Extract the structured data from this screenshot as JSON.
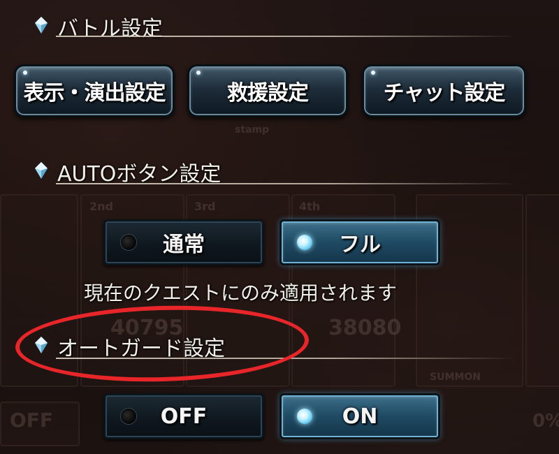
{
  "battle_settings": {
    "title": "バトル設定",
    "buttons": [
      {
        "label": "表示・演出設定"
      },
      {
        "label": "救援設定"
      },
      {
        "label": "チャット設定"
      }
    ]
  },
  "auto_button_settings": {
    "title": "AUTOボタン設定",
    "options": [
      {
        "label": "通常",
        "selected": false
      },
      {
        "label": "フル",
        "selected": true
      }
    ],
    "note": "現在のクエストにのみ適用されます"
  },
  "auto_guard_settings": {
    "title": "オートガード設定",
    "options": [
      {
        "label": "OFF",
        "selected": false
      },
      {
        "label": "ON",
        "selected": true
      }
    ]
  },
  "background": {
    "faint_texts": [
      "2nd",
      "3rd",
      "4th",
      "40795",
      "38080",
      "SUMMON",
      "OFF",
      "0%",
      "stamp"
    ]
  },
  "colors": {
    "annotation": "#e8262a",
    "selected_accent": "#4fc1ee"
  },
  "icons": [
    "gem-icon",
    "radio-dot-icon"
  ]
}
